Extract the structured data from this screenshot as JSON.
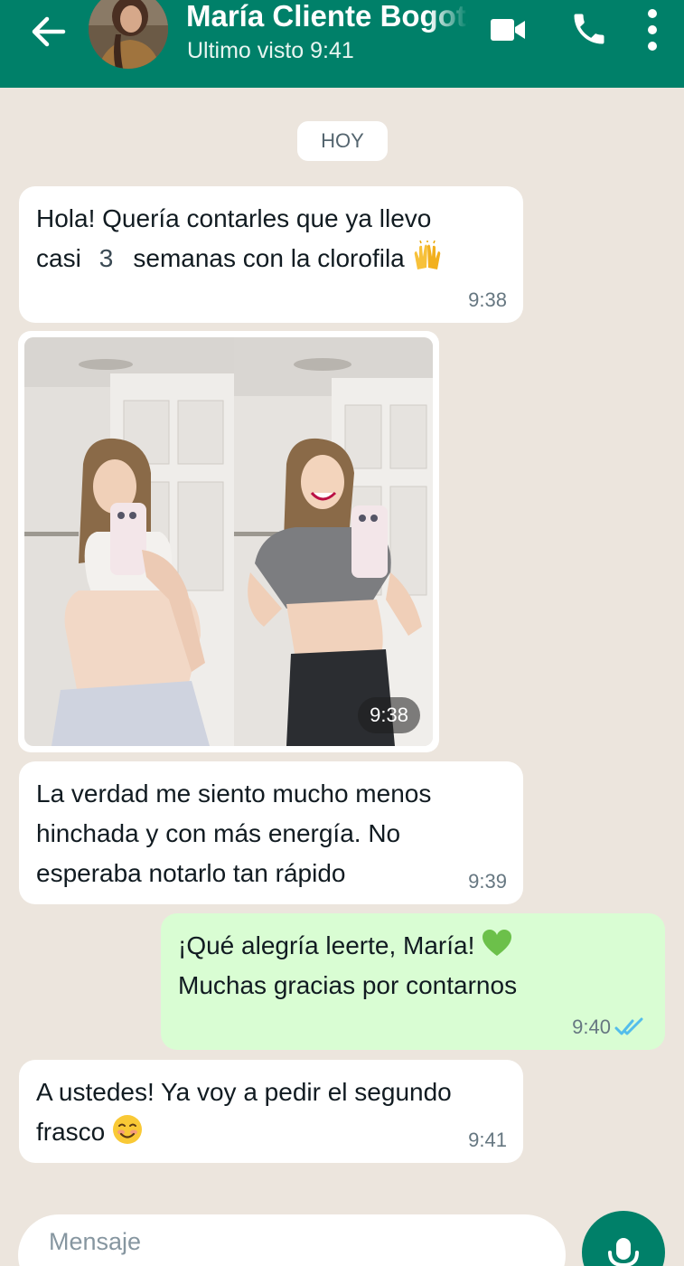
{
  "header": {
    "contact_name": "María Cliente Bogotá",
    "status": "Ultimo visto 9:41",
    "icons": [
      "back-arrow-icon",
      "video-camera-icon",
      "phone-icon",
      "more-vert-icon"
    ],
    "color": "#008069"
  },
  "date_chip": "HOY",
  "messages": [
    {
      "direction": "in",
      "text_line1": "Hola! Quería contarles que ya llevo",
      "text_line2_a": "casi",
      "text_line2_num": "3",
      "text_line2_b": "semanas con la clorofila",
      "emoji": "raising-hands",
      "time": "9:38"
    },
    {
      "direction": "in",
      "type": "image",
      "image_description": "before-after-selfie",
      "time": "9:38"
    },
    {
      "direction": "in",
      "text_line1": "La verdad me siento mucho menos",
      "text_line2": "hinchada y con más energía. No",
      "text_line3": "esperaba notarlo tan rápido",
      "time": "9:39"
    },
    {
      "direction": "out",
      "text_line1": "¡Qué alegría leerte, María!",
      "emoji": "green-heart",
      "text_line2": "Muchas gracias por contarnos",
      "time": "9:40",
      "status": "delivered"
    },
    {
      "direction": "in",
      "text_line1": "A ustedes! Ya voy a pedir el segundo",
      "text_line2": "frasco",
      "emoji": "smiling-face",
      "time": "9:41"
    }
  ],
  "composer": {
    "placeholder": "Mensaje",
    "mic_icon": "microphone-icon"
  },
  "colors": {
    "background": "#ece5dd",
    "incoming_bubble": "#ffffff",
    "outgoing_bubble": "#d9fdd3",
    "tick_blue": "#53bdeb"
  }
}
